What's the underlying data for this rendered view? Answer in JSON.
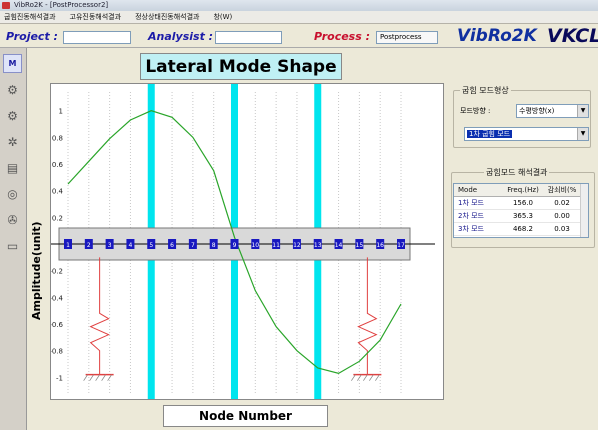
{
  "window": {
    "title": "VibRo2K - [PostProcessor2]"
  },
  "menu": [
    "굽힘진동해석결과",
    "고유진동해석결과",
    "정상상태진동해석결과",
    "창(W)"
  ],
  "header": {
    "project_label": "Project :",
    "project_value": "",
    "analysist_label": "Analysist :",
    "analysist_value": "",
    "process_label": "Process :",
    "process_value": "Postprocess",
    "brand_name": "VibRo2K",
    "brand_logo_main": "VKCL",
    "brand_logo_accent": "L"
  },
  "colors": {
    "accent_blue": "#1c1ca8",
    "accent_red": "#c8102e",
    "mode_line": "#2aa52a",
    "cyan_band": "#00e5ee",
    "spring_red": "#e04040",
    "node_blue": "#1818c0"
  },
  "chart_title": "Lateral Mode Shape",
  "chart_xlabel": "Node Number",
  "chart_ylabel": "Amplitude(unit)",
  "chart_data": {
    "type": "line",
    "title": "Lateral Mode Shape",
    "xlabel": "Node Number",
    "ylabel": "Amplitude(unit)",
    "x": [
      1,
      2,
      3,
      4,
      5,
      6,
      7,
      8,
      9,
      10,
      11,
      12,
      13,
      14,
      15,
      16,
      17
    ],
    "series": [
      {
        "values": [
          0.45,
          0.62,
          0.79,
          0.93,
          1.0,
          0.95,
          0.8,
          0.55,
          0.05,
          -0.35,
          -0.62,
          -0.8,
          -0.93,
          -0.97,
          -0.88,
          -0.72,
          -0.45
        ]
      }
    ],
    "ylim": [
      -1.05,
      1.05
    ],
    "y_ticks": [
      "1",
      "0.8",
      "0.6",
      "0.4",
      "0.2",
      "0",
      "-0.2",
      "-0.4",
      "-0.6",
      "-0.8",
      "-1"
    ],
    "node_labels": [
      "1",
      "2",
      "3",
      "4",
      "5",
      "6",
      "7",
      "8",
      "9",
      "10",
      "11",
      "12",
      "13",
      "14",
      "15",
      "16",
      "17"
    ],
    "highlighted_nodes": [
      5,
      9,
      13
    ],
    "grid": "vertical dotted"
  },
  "side": {
    "mode_group_title": "굽힘 모드형상",
    "direction_label": "모드방향 :",
    "direction_value": "수평방향(x)",
    "mode_select_value": "1차 굽힘 모드",
    "results_title": "굽힘모드 해석결과",
    "table_headers": [
      "Mode",
      "Freq.(Hz)",
      "감쇠비(%"
    ],
    "table_rows": [
      [
        "1차 모드",
        "156.0",
        "0.02"
      ],
      [
        "2차 모드",
        "365.3",
        "0.00"
      ],
      [
        "3차 모드",
        "468.2",
        "0.03"
      ]
    ]
  }
}
